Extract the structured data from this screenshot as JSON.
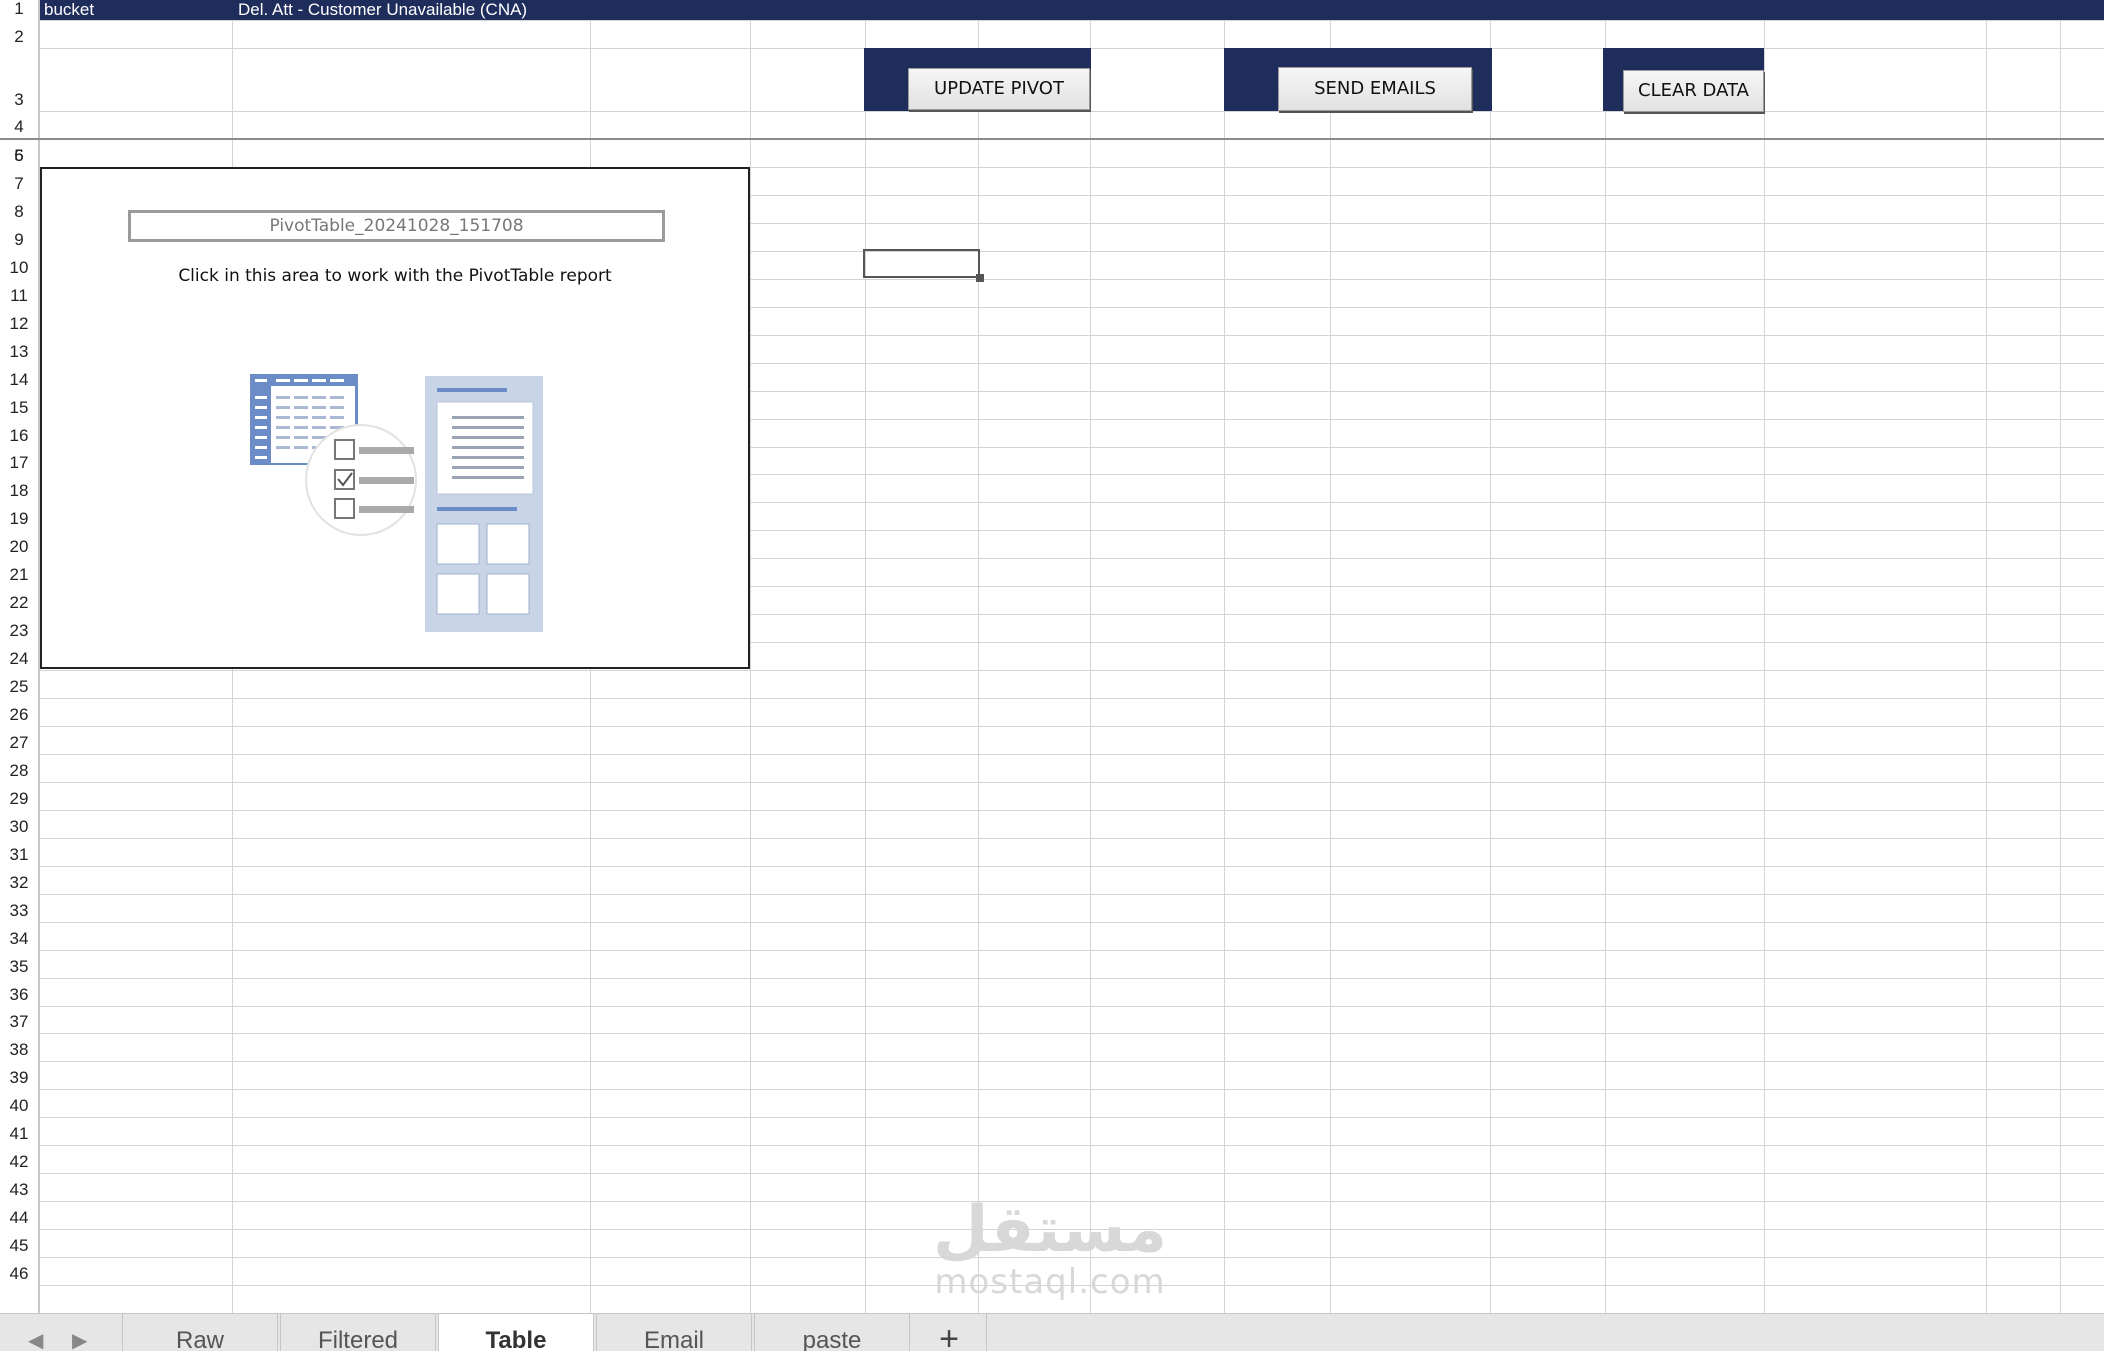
{
  "sheet": {
    "row1": {
      "col_a": "bucket",
      "col_b": "Del. Att - Customer Unavailable (CNA)"
    },
    "row_numbers": [
      "1",
      "2",
      "3",
      "4",
      "5",
      "6",
      "7",
      "8",
      "9",
      "10",
      "11",
      "12",
      "13",
      "14",
      "15",
      "16",
      "17",
      "18",
      "19",
      "20",
      "21",
      "22",
      "23",
      "24",
      "25",
      "26",
      "27",
      "28",
      "29",
      "30",
      "31",
      "32",
      "33",
      "34",
      "35",
      "36",
      "37",
      "38",
      "39",
      "40",
      "41",
      "42",
      "43",
      "44",
      "45",
      "46"
    ],
    "active_cell": "F9"
  },
  "buttons": {
    "update_pivot": "UPDATE PIVOT",
    "send_emails": "SEND EMAILS",
    "clear_data": "CLEAR DATA"
  },
  "pivot": {
    "name": "PivotTable_20241028_151708",
    "hint": "Click in this area to work with the PivotTable report"
  },
  "watermark": {
    "logo": "مستقل",
    "url": "mostaql.com"
  },
  "tabs": [
    "Raw",
    "Filtered",
    "Table",
    "Email",
    "paste"
  ],
  "active_tab": "Table",
  "add_sheet": "+",
  "colors": {
    "header_band": "#1f2d5c",
    "grid": "#d4d4d4"
  }
}
